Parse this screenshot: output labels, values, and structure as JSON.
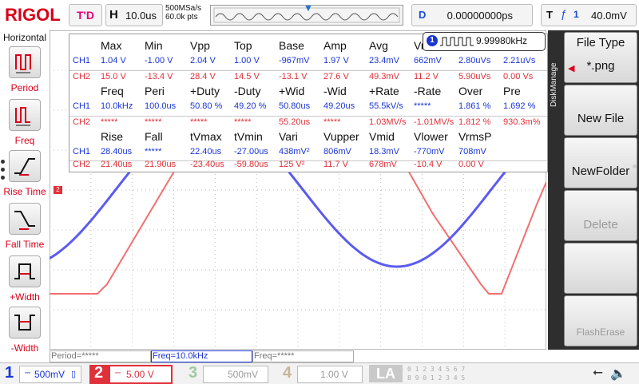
{
  "brand": "RIGOL",
  "top": {
    "status": "T'D",
    "horizontal_key": "H",
    "timebase": "10.0us",
    "sample_rate": "500MSa/s",
    "mem_depth": "60.0k pts",
    "delay_key": "D",
    "delay_value": "0.00000000ps",
    "trigger_key": "T",
    "trigger_source": "1",
    "trigger_level": "40.0mV"
  },
  "left_panel": {
    "title": "Horizontal",
    "items": [
      {
        "label": "Period"
      },
      {
        "label": "Freq"
      },
      {
        "label": "Rise Time"
      },
      {
        "label": "Fall Time"
      },
      {
        "label": "+Width"
      },
      {
        "label": "-Width"
      }
    ]
  },
  "freq_counter": {
    "channel": "1",
    "value": "9.99980kHz"
  },
  "measurements": {
    "section1": {
      "headers": [
        "Max",
        "Min",
        "Vpp",
        "Top",
        "Base",
        "Amp",
        "Avg",
        "Vr"
      ],
      "ch1": {
        "label": "CH1",
        "values": [
          "1.04 V",
          "-1.00 V",
          "2.04 V",
          "1.00 V",
          "-967mV",
          "1.97 V",
          "23.4mV",
          "662mV",
          "2.80uVs",
          "2.21uVs"
        ]
      },
      "ch2": {
        "label": "CH2",
        "values": [
          "15.0 V",
          "-13.4 V",
          "28.4 V",
          "14.5 V",
          "-13.1 V",
          "27.6 V",
          "49.3mV",
          "11.2 V",
          "5.90uVs",
          "0.00 Vs"
        ]
      }
    },
    "section2": {
      "headers": [
        "Freq",
        "Peri",
        "+Duty",
        "-Duty",
        "+Wid",
        "-Wid",
        "+Rate",
        "-Rate",
        "Over",
        "Pre"
      ],
      "ch1": {
        "label": "CH1",
        "values": [
          "10.0kHz",
          "100.0us",
          "50.80 %",
          "49.20 %",
          "50.80us",
          "49.20us",
          "55.5kV/s",
          "*****",
          "1.861 %",
          "1.692 %"
        ]
      },
      "ch2": {
        "label": "CH2",
        "values": [
          "*****",
          "*****",
          "*****",
          "*****",
          "55.20us",
          "*****",
          "1.03MV/s",
          "-1.01MV/s",
          "1.812 %",
          "930.3m%"
        ]
      }
    },
    "section3": {
      "headers": [
        "Rise",
        "Fall",
        "tVmax",
        "tVmin",
        "Vari",
        "Vupper",
        "Vmid",
        "Vlower",
        "VrmsP"
      ],
      "ch1": {
        "label": "CH1",
        "values": [
          "28.40us",
          "*****",
          "22.40us",
          "-27.00us",
          "438mV²",
          "806mV",
          "18.3mV",
          "-770mV",
          "708mV"
        ]
      },
      "ch2": {
        "label": "CH2",
        "values": [
          "21.40us",
          "21.90us",
          "-23.40us",
          "-59.80us",
          "125 V²",
          "11.7 V",
          "678mV",
          "-10.4 V",
          "0.00 V"
        ]
      }
    }
  },
  "right_panel": {
    "tab": "DiskManage",
    "file_type_label": "File Type",
    "file_type_value": "*.png",
    "new_file": "New File",
    "new_folder": "NewFolder",
    "delete": "Delete",
    "flash_erase": "FlashErase"
  },
  "stat_bar": {
    "period": "Period=*****",
    "freq": "Freq=10.0kHz",
    "freq2": "Freq=*****"
  },
  "channels": [
    {
      "num": "1",
      "scale": "500mV",
      "color": "#1a35d6"
    },
    {
      "num": "2",
      "scale": "5.00 V",
      "color": "#e0303a"
    },
    {
      "num": "3",
      "scale": "500mV",
      "color": "#9fc99f"
    },
    {
      "num": "4",
      "scale": "1.00 V",
      "color": "#c9b49a"
    }
  ],
  "la_label": "LA",
  "la_bits_top": "0 1 2 3  4 5 6 7",
  "la_bits_bottom": "8 9 0 1  2 3 4 5",
  "colors": {
    "ch1": "#1a35d6",
    "ch2": "#e0303a",
    "accent": "#d8001b"
  }
}
